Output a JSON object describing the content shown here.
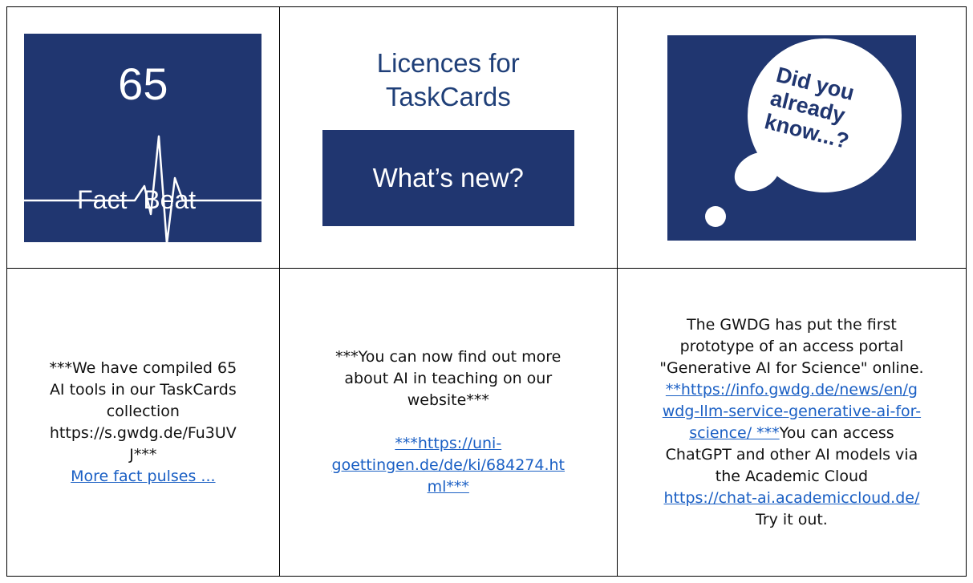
{
  "cell1": {
    "tile_number": "65",
    "tile_label_left": "Fact",
    "tile_label_right": "Beat",
    "text_lines": [
      "***We have compiled 65",
      "AI tools in our TaskCards",
      "collection",
      "https://s.gwdg.de/Fu3UV",
      "J***"
    ],
    "link": "More fact pulses ..."
  },
  "cell2": {
    "title_lines": [
      "Licences for",
      "TaskCards"
    ],
    "banner": "What’s new?",
    "text_lines": [
      "***You can now find out more",
      "about AI in teaching on our",
      "website***"
    ],
    "link_lines": [
      "***https://uni-",
      "goettingen.de/de/ki/684274.ht",
      "ml***"
    ]
  },
  "cell3": {
    "bubble_lines": [
      "Did you",
      "already",
      "know...?"
    ],
    "line1": "The GWDG has put the first",
    "line2": "prototype of an access portal",
    "line3": "\"Generative AI for Science\" online.",
    "link1_a": "**https://info.gwdg.de/news/en/g",
    "link1_b": "wdg-llm-service-generative-ai-for-",
    "link1_c": "science/ ***",
    "after_link1": "You can access",
    "line5": "ChatGPT and other AI models via",
    "line6": "the Academic Cloud",
    "link2": "https://chat-ai.academiccloud.de/",
    "line7": "Try it out."
  },
  "colors": {
    "tile_navy": "#203670",
    "title_blue": "#1f3f78",
    "link_blue": "#1a5fc4"
  }
}
